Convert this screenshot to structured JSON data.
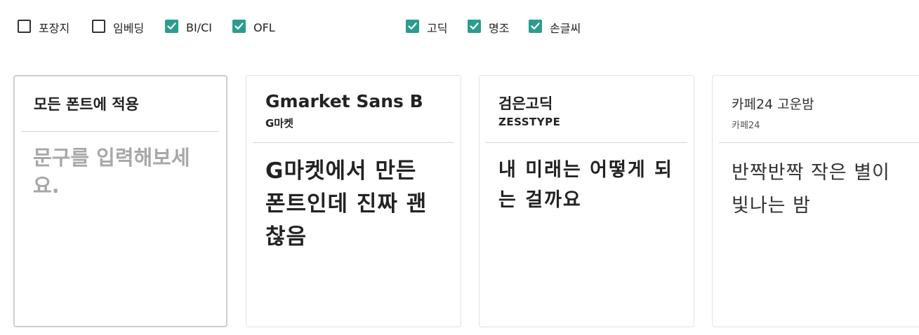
{
  "filters": [
    {
      "label": "포장지",
      "checked": false
    },
    {
      "label": "임베딩",
      "checked": false
    },
    {
      "label": "BI/CI",
      "checked": true
    },
    {
      "label": "OFL",
      "checked": true
    },
    {
      "label": "고딕",
      "checked": true
    },
    {
      "label": "명조",
      "checked": true
    },
    {
      "label": "손글씨",
      "checked": true
    }
  ],
  "custom": {
    "title": "모든 폰트에 적용",
    "placeholder": "문구를 입력해보세요."
  },
  "fonts": [
    {
      "name": "Gmarket Sans B",
      "foundry": "G마켓",
      "sample": "G마켓에서 만든 폰트인데 진짜 괜찮음"
    },
    {
      "name": "검은고딕",
      "foundry": "ZESSTYPE",
      "sample": "내 미래는 어떻게 되는 걸까요"
    },
    {
      "name": "카페24 고운밤",
      "foundry": "카페24",
      "sample": "반짝반짝 작은 별이 빛나는 밤"
    }
  ],
  "colors": {
    "accent": "#2a9d8f"
  }
}
